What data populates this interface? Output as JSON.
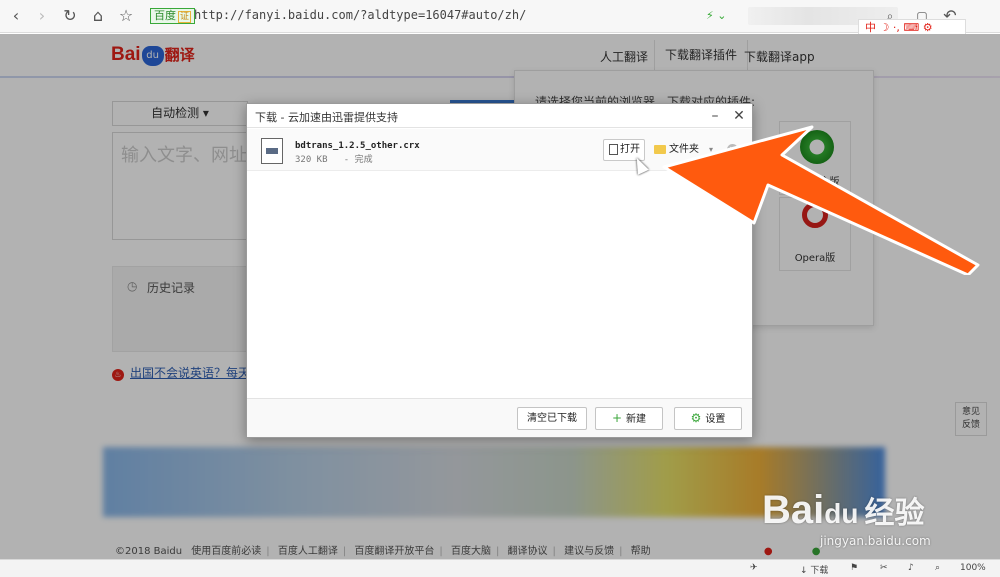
{
  "browser": {
    "back_icon": "back-arrow-icon",
    "address_badge": "百度",
    "address_badge_verified": "证",
    "url": "http://fanyi.baidu.com/?aldtype=16047#auto/zh/",
    "ime_label": "中"
  },
  "site": {
    "logo_text": "Bai",
    "logo_paw": "du",
    "logo_fanyi": "翻译",
    "nav": [
      "人工翻译",
      "下载翻译插件",
      "下载翻译app"
    ]
  },
  "translate": {
    "source_lang": "自动检测",
    "input_placeholder": "输入文字、网址",
    "history_label": "历史记录",
    "promo_text": "出国不会说英语？每天5"
  },
  "plugin_panel": {
    "title": "请选择您当前的浏览器，下载对应的插件:",
    "cards": [
      {
        "label": "360安全版"
      },
      {
        "label": "Opera版"
      }
    ]
  },
  "download_dialog": {
    "title": "下载 - 云加速由迅雷提供支持",
    "file": {
      "name": "bdtrans_1.2.5_other.crx",
      "size": "320 KB",
      "status": "- 完成"
    },
    "open_label": "打开",
    "folder_label": "文件夹",
    "clear_label": "清空已下载",
    "new_label": "新建",
    "settings_label": "设置"
  },
  "footer": {
    "copyright": "©2018 Baidu",
    "links": [
      "使用百度前必读",
      "百度人工翻译",
      "百度翻译开放平台",
      "百度大脑",
      "翻译协议",
      "建议与反馈",
      "帮助"
    ]
  },
  "feedback": {
    "line1": "意见",
    "line2": "反馈"
  },
  "watermark": {
    "text": "Bai",
    "du": "du",
    "jy": "经验",
    "sub": "jingyan.baidu.com"
  },
  "statusbar": {
    "download": "下载",
    "zoom": "100%"
  },
  "colors": {
    "accent_orange": "#ff5a0e",
    "baidu_red": "#e2231a",
    "baidu_blue": "#2b66d9"
  }
}
